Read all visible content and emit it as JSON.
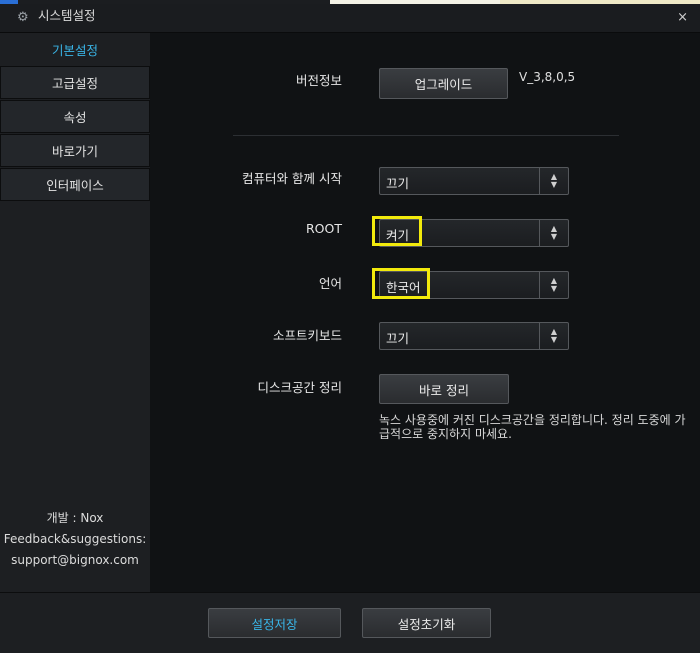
{
  "window": {
    "title": "시스템설정",
    "close_glyph": "×",
    "gear_glyph": "⚙"
  },
  "sidebar": {
    "items": [
      {
        "label": "기본설정",
        "active": true
      },
      {
        "label": "고급설정",
        "active": false
      },
      {
        "label": "속성",
        "active": false
      },
      {
        "label": "바로가기",
        "active": false
      },
      {
        "label": "인터페이스",
        "active": false
      }
    ],
    "credits": {
      "developer": "개발 : Nox",
      "feedback": "Feedback&suggestions:",
      "email": "support@bignox.com"
    }
  },
  "main": {
    "version": {
      "label": "버전정보",
      "upgrade_button": "업그레이드",
      "value": "V_3,8,0,5"
    },
    "startup": {
      "label": "컴퓨터와 함께 시작",
      "value": "끄기"
    },
    "root": {
      "label": "ROOT",
      "value": "켜기"
    },
    "language": {
      "label": "언어",
      "value": "한국어"
    },
    "soft_keyboard": {
      "label": "소프트키보드",
      "value": "끄기"
    },
    "disk_cleanup": {
      "label": "디스크공간 정리",
      "button": "바로 정리",
      "description": "녹스 사용중에 커진 디스크공간을 정리합니다. 정리 도중에 가급적으로 중지하지 마세요."
    }
  },
  "footer": {
    "save_button": "설정저장",
    "reset_button": "설정초기화"
  },
  "colors": {
    "accent": "#39b4e6",
    "highlight": "#f2ea0c",
    "background": "#101214"
  }
}
